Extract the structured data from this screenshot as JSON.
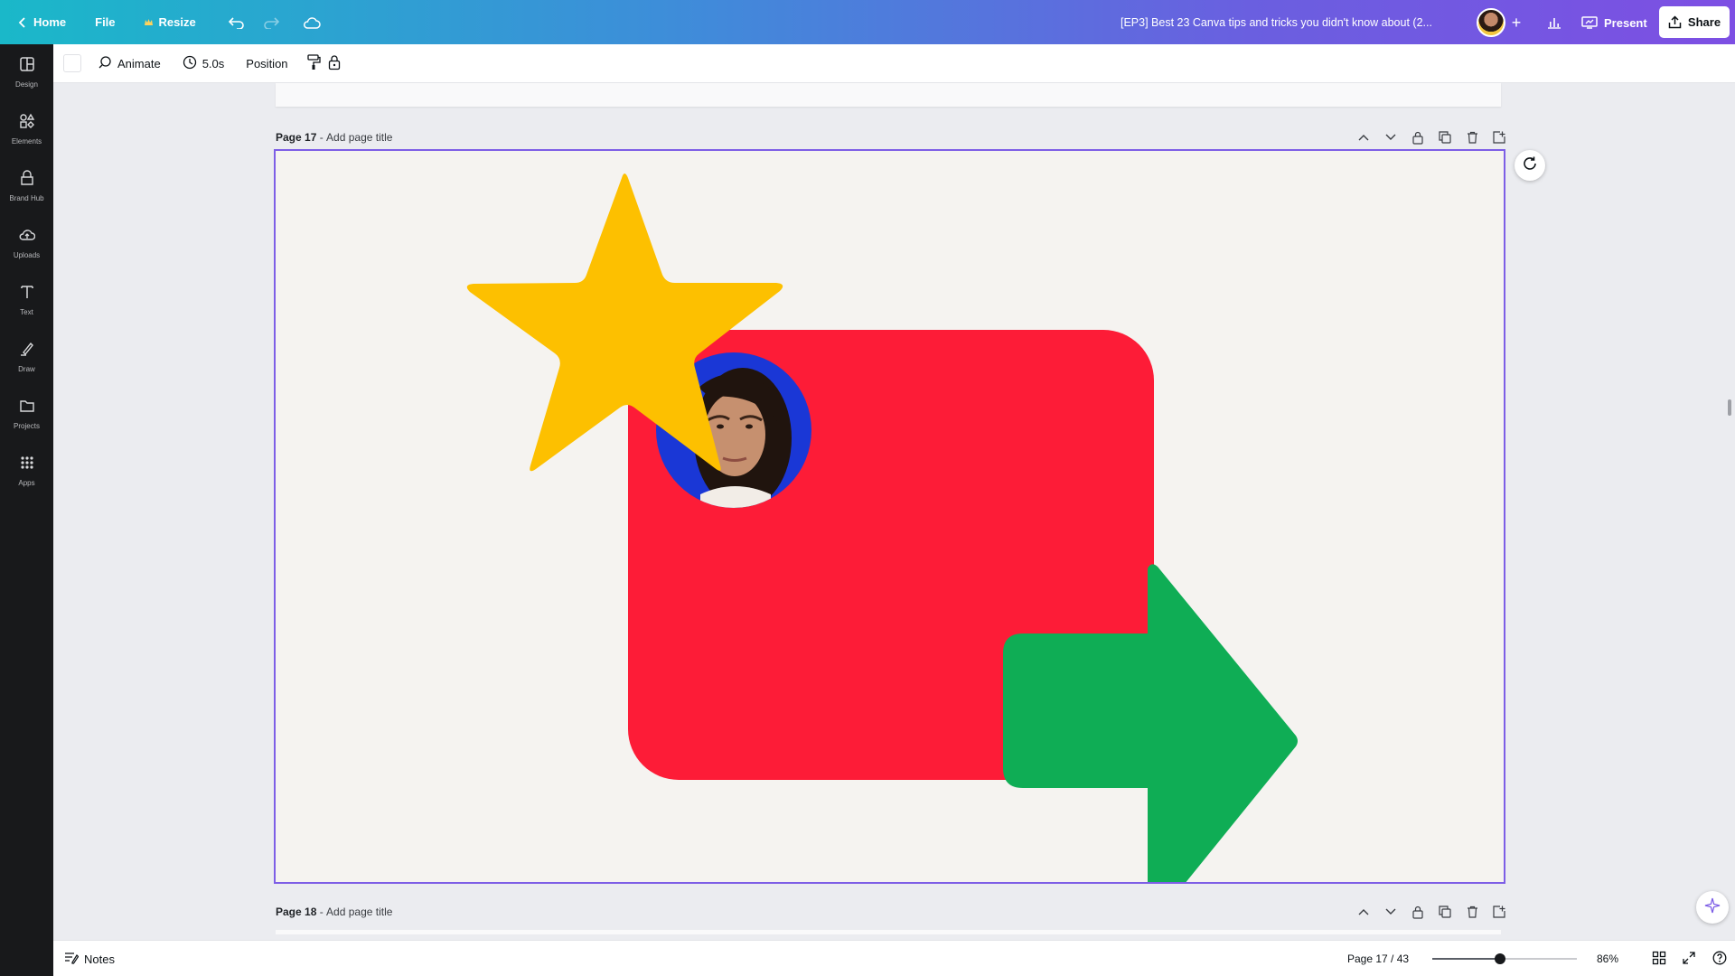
{
  "topbar": {
    "home_label": "Home",
    "file_label": "File",
    "resize_label": "Resize",
    "doc_title": "[EP3] Best 23 Canva tips and tricks you didn't know about (2...",
    "present_label": "Present",
    "share_label": "Share",
    "plus_symbol": "+"
  },
  "rail": {
    "items": [
      {
        "label": "Design",
        "icon": "design-icon"
      },
      {
        "label": "Elements",
        "icon": "elements-icon"
      },
      {
        "label": "Brand Hub",
        "icon": "brand-hub-icon"
      },
      {
        "label": "Uploads",
        "icon": "uploads-icon"
      },
      {
        "label": "Text",
        "icon": "text-icon"
      },
      {
        "label": "Draw",
        "icon": "draw-icon"
      },
      {
        "label": "Projects",
        "icon": "projects-icon"
      },
      {
        "label": "Apps",
        "icon": "apps-icon"
      }
    ]
  },
  "toolbar": {
    "animate_label": "Animate",
    "duration_label": "5.0s",
    "position_label": "Position"
  },
  "pages": {
    "current_page_number": "Page 17",
    "current_page_title_placeholder": "Add page title",
    "next_page_number": "Page 18",
    "next_page_title_placeholder": "Add page title",
    "separator": " - "
  },
  "canvas": {
    "background": "#f5f3f0",
    "selection_color": "#7d5ee6",
    "shapes": {
      "star_color": "#fdc000",
      "rectangle_color": "#fd1c37",
      "arrow_color": "#0fad55",
      "photo_backdrop_color": "#1a37d6"
    }
  },
  "footer": {
    "notes_label": "Notes",
    "page_indicator": "Page 17 / 43",
    "zoom_label": "86%",
    "zoom_fraction": 0.47
  },
  "colors": {
    "accent": "#7d5ee6",
    "rail_bg": "#18191b"
  }
}
